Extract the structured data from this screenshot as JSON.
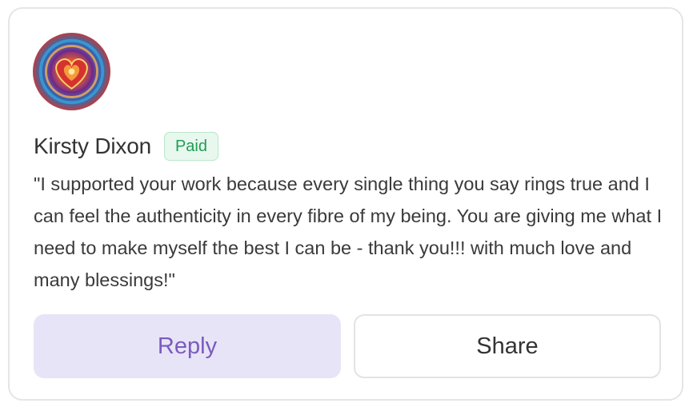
{
  "supporter": {
    "name": "Kirsty Dixon",
    "badge": "Paid",
    "avatar_icon": "psychedelic-heart-avatar",
    "message": "\"I supported your work because every single thing you say rings true and I can feel the authenticity in every fibre of my being. You are giving me what I need to make myself the best I can be - thank you!!! with much love and many blessings!\""
  },
  "actions": {
    "reply_label": "Reply",
    "share_label": "Share"
  },
  "colors": {
    "badge_text": "#1f9d55",
    "badge_bg": "#e8f8ee",
    "reply_bg": "#e8e4f7",
    "reply_text": "#7a5bbf"
  }
}
